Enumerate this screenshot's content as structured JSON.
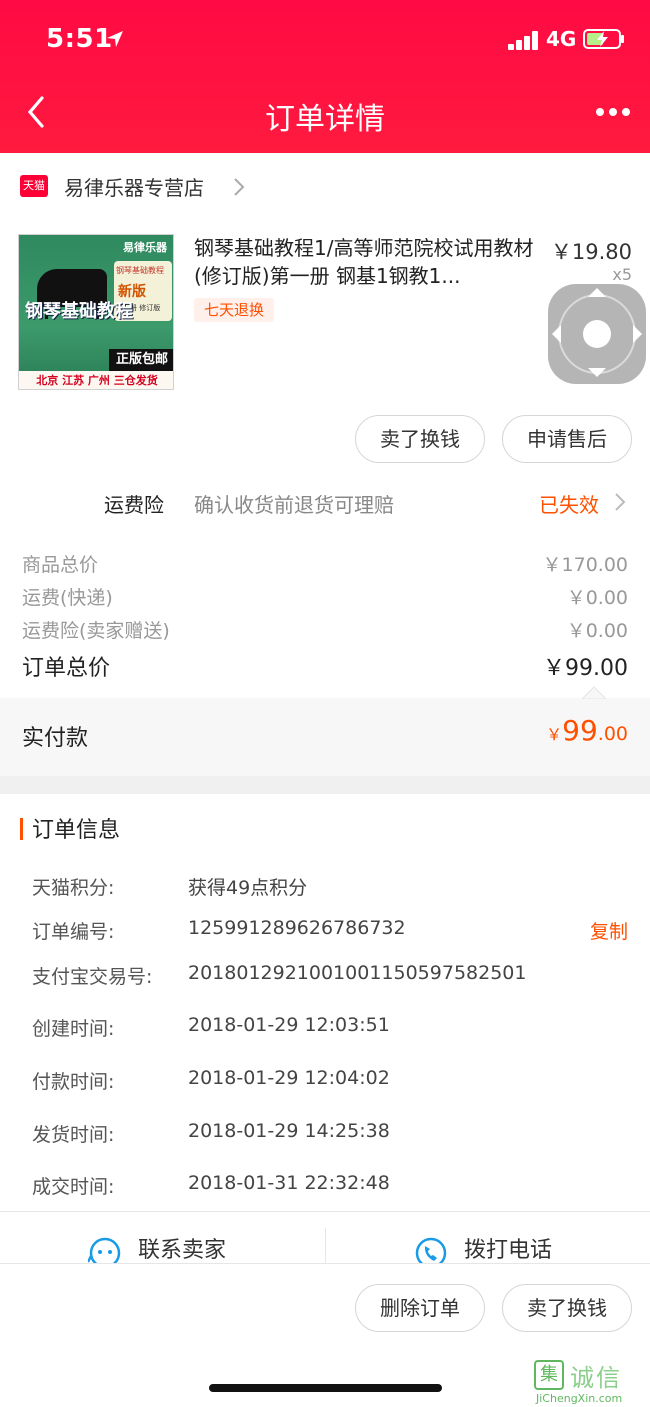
{
  "status_bar": {
    "time": "5:51",
    "network": "4G"
  },
  "nav": {
    "title": "订单详情"
  },
  "shop": {
    "badge": "天猫",
    "name": "易律乐器专营店"
  },
  "product": {
    "image_texts": {
      "brand": "易律乐器",
      "cover_line1": "钢琴基础教程",
      "cover_line2": "新版",
      "cover_sub": "第一册 修订版",
      "vertical_title": "钢琴基础教程",
      "ribbon": "正版包邮",
      "bottom": "北京 江苏 广州 三仓发货"
    },
    "title": "钢琴基础教程1/高等师范院校试用教材(修订版)第一册 钢基1钢教1...",
    "tag": "七天退换",
    "unit_price": "￥19.80",
    "quantity": "x5"
  },
  "actions": {
    "sell_label": "卖了换钱",
    "aftersale_label": "申请售后"
  },
  "insurance": {
    "label": "运费险",
    "desc": "确认收货前退货可理赔",
    "status": "已失效"
  },
  "summary": {
    "goods_total_label": "商品总价",
    "goods_total": "￥170.00",
    "shipping_label": "运费(快递)",
    "shipping": "￥0.00",
    "insurance_label": "运费险(卖家赠送)",
    "insurance": "￥0.00",
    "order_total_label": "订单总价",
    "order_total": "￥99.00"
  },
  "paid": {
    "label": "实付款",
    "yen": "￥",
    "int": "99",
    "dec": ".00"
  },
  "order_info": {
    "title": "订单信息",
    "rows": [
      {
        "key": "天猫积分:",
        "value": "获得49点积分"
      },
      {
        "key": "订单编号:",
        "value": "125991289626786732"
      },
      {
        "key": "支付宝交易号:",
        "value": "2018012921001001150597582501"
      },
      {
        "key": "创建时间:",
        "value": "2018-01-29 12:03:51"
      },
      {
        "key": "付款时间:",
        "value": "2018-01-29 12:04:02"
      },
      {
        "key": "发货时间:",
        "value": "2018-01-29 14:25:38"
      },
      {
        "key": "成交时间:",
        "value": "2018-01-31 22:32:48"
      }
    ],
    "copy_label": "复制"
  },
  "contact": {
    "seller_label": "联系卖家",
    "phone_label": "拨打电话"
  },
  "footer": {
    "delete_label": "删除订单",
    "sell_label": "卖了换钱"
  },
  "watermark": {
    "logo": "集",
    "text": "诚信",
    "url": "JiChengXin.com"
  },
  "colors": {
    "brand_red": "#ff1a3e",
    "accent_orange": "#ff5000",
    "tmall_red": "#ff0036",
    "contact_blue": "#1a9be8"
  }
}
